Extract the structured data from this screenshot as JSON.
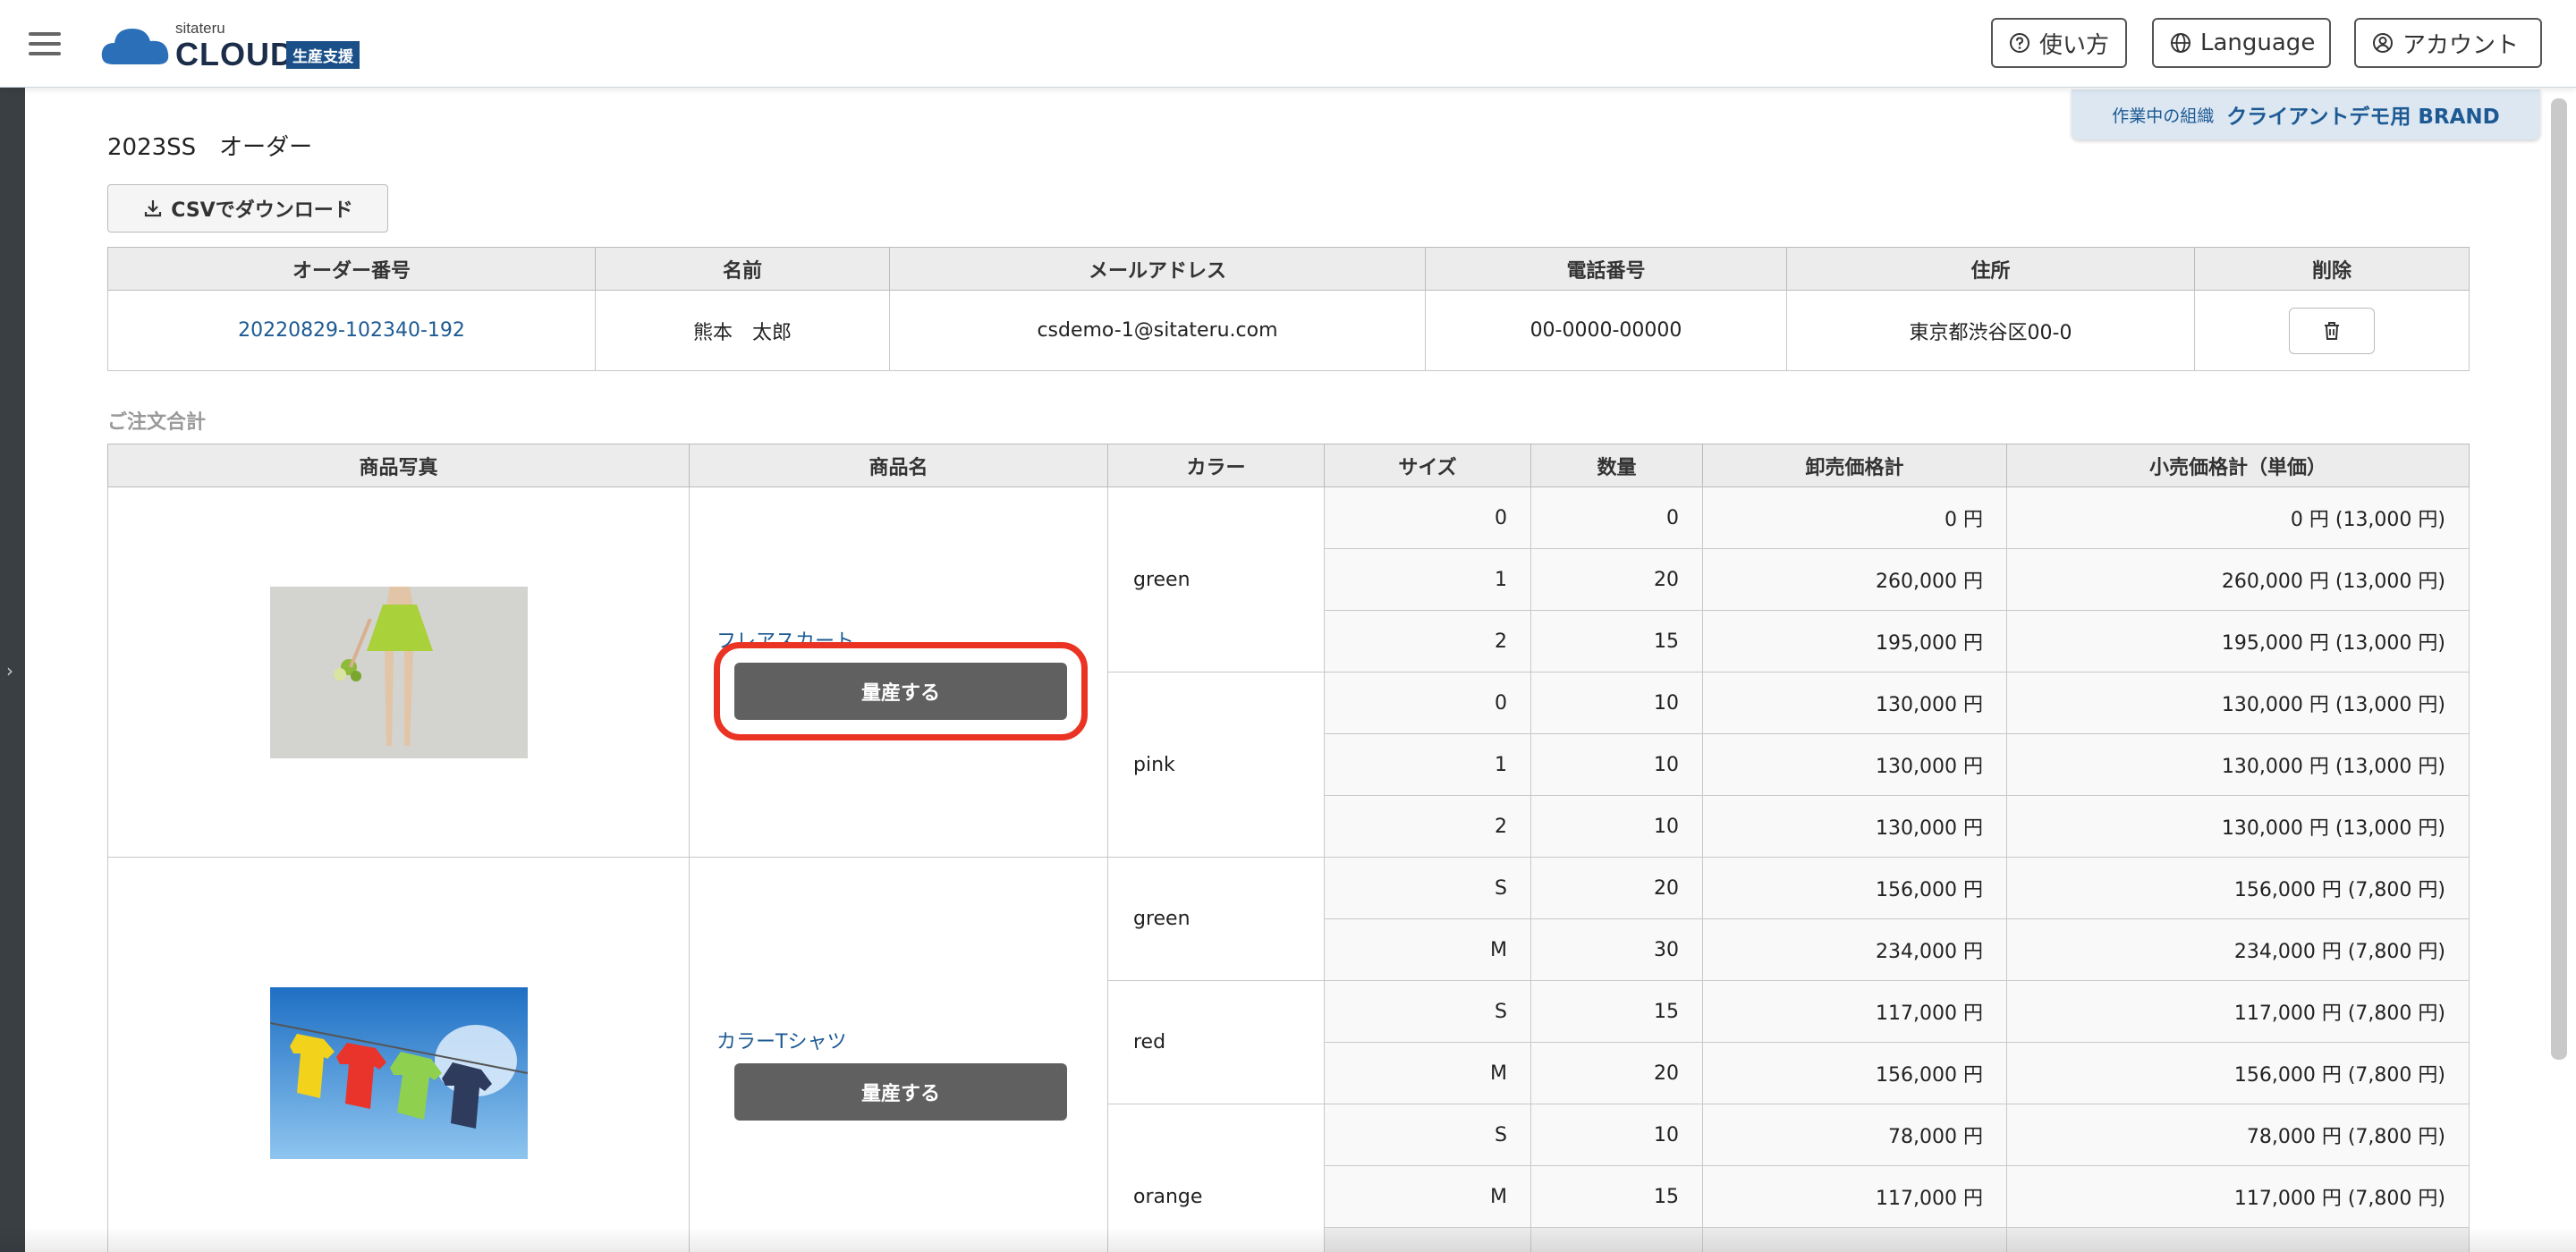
{
  "header": {
    "logo_small": "sitateru",
    "logo_big": "CLOUD",
    "logo_badge": "生産支援",
    "help_label": "使い方",
    "language_label": "Language",
    "account_label": "アカウント"
  },
  "org": {
    "label": "作業中の組織",
    "value": "クライアントデモ用 BRAND"
  },
  "page": {
    "title": "2023SS　オーダー",
    "csv_label": "CSVでダウンロード"
  },
  "order_table": {
    "headers": [
      "オーダー番号",
      "名前",
      "メールアドレス",
      "電話番号",
      "住所",
      "削除"
    ],
    "row": {
      "order_no": "20220829-102340-192",
      "name": "熊本　太郎",
      "email": "csdemo-1@sitateru.com",
      "phone": "00-0000-00000",
      "address": "東京都渋谷区00-0"
    }
  },
  "summary_label": "ご注文合計",
  "items_table": {
    "headers": [
      "商品写真",
      "商品名",
      "カラー",
      "サイズ",
      "数量",
      "卸売価格計",
      "小売価格計（単価）"
    ],
    "products": [
      {
        "name": "フレアスカート",
        "button": "量産する",
        "colors": [
          {
            "color": "green",
            "rows": [
              {
                "size": "0",
                "qty": "0",
                "wholesale": "0 円",
                "retail": "0 円 (13,000 円)"
              },
              {
                "size": "1",
                "qty": "20",
                "wholesale": "260,000 円",
                "retail": "260,000 円 (13,000 円)"
              },
              {
                "size": "2",
                "qty": "15",
                "wholesale": "195,000 円",
                "retail": "195,000 円 (13,000 円)"
              }
            ]
          },
          {
            "color": "pink",
            "rows": [
              {
                "size": "0",
                "qty": "10",
                "wholesale": "130,000 円",
                "retail": "130,000 円 (13,000 円)"
              },
              {
                "size": "1",
                "qty": "10",
                "wholesale": "130,000 円",
                "retail": "130,000 円 (13,000 円)"
              },
              {
                "size": "2",
                "qty": "10",
                "wholesale": "130,000 円",
                "retail": "130,000 円 (13,000 円)"
              }
            ]
          }
        ]
      },
      {
        "name": "カラーTシャツ",
        "button": "量産する",
        "colors": [
          {
            "color": "green",
            "rows": [
              {
                "size": "S",
                "qty": "20",
                "wholesale": "156,000 円",
                "retail": "156,000 円 (7,800 円)"
              },
              {
                "size": "M",
                "qty": "30",
                "wholesale": "234,000 円",
                "retail": "234,000 円 (7,800 円)"
              }
            ]
          },
          {
            "color": "red",
            "rows": [
              {
                "size": "S",
                "qty": "15",
                "wholesale": "117,000 円",
                "retail": "117,000 円 (7,800 円)"
              },
              {
                "size": "M",
                "qty": "20",
                "wholesale": "156,000 円",
                "retail": "156,000 円 (7,800 円)"
              }
            ]
          },
          {
            "color": "orange",
            "rows": [
              {
                "size": "S",
                "qty": "10",
                "wholesale": "78,000 円",
                "retail": "78,000 円 (7,800 円)"
              },
              {
                "size": "M",
                "qty": "15",
                "wholesale": "117,000 円",
                "retail": "117,000 円 (7,800 円)"
              }
            ]
          }
        ]
      }
    ]
  },
  "icons": {
    "menu": "hamburger-icon",
    "help": "question-circle-icon",
    "language": "globe-icon",
    "account": "user-circle-icon",
    "download": "download-icon",
    "delete": "trash-icon",
    "sidebar_toggle": "chevron-right-icon"
  },
  "colors": {
    "brand_blue": "#1d5a93",
    "highlight_red": "#ea3323",
    "button_gray": "#606060"
  }
}
